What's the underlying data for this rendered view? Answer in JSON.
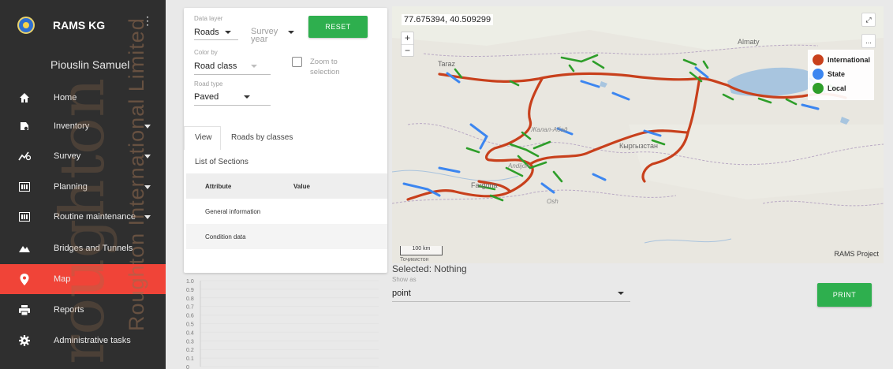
{
  "sidebar": {
    "app_title": "RAMS KG",
    "user_name": "Piouslin Samuel",
    "items": [
      {
        "label": "Home",
        "icon": "home-icon"
      },
      {
        "label": "Inventory",
        "icon": "inventory-icon"
      },
      {
        "label": "Survey",
        "icon": "survey-icon"
      },
      {
        "label": "Planning",
        "icon": "planning-icon"
      },
      {
        "label": "Routine maintenance",
        "icon": "routine-maintenance-icon"
      },
      {
        "label": "Bridges and Tunnels",
        "icon": "bridges-tunnels-icon"
      },
      {
        "label": "Map",
        "icon": "map-pin-icon"
      },
      {
        "label": "Reports",
        "icon": "print-icon"
      },
      {
        "label": "Administrative tasks",
        "icon": "gear-icon"
      }
    ],
    "active_item": "Map",
    "active_color": "#f04438"
  },
  "watermark": {
    "line1": "Roughton International Limited",
    "line2": "roughton"
  },
  "controls": {
    "data_layer_label": "Data layer",
    "data_layer_value": "Roads",
    "survey_year_placeholder": "Survey year",
    "reset_label": "RESET",
    "color_by_label": "Color by",
    "color_by_value": "Road class",
    "zoom_to_selection_label": "Zoom to selection",
    "road_type_label": "Road type",
    "road_type_value": "Paved",
    "tabs": [
      "View",
      "Roads by classes"
    ],
    "list_title": "List of Sections",
    "table_headers": [
      "Attribute",
      "Value"
    ],
    "table_rows": [
      "General information",
      "Condition data"
    ]
  },
  "chart_data": {
    "type": "line",
    "yticks": [
      "1.0",
      "0.9",
      "0.8",
      "0.7",
      "0.6",
      "0.5",
      "0.4",
      "0.3",
      "0.2",
      "0.1",
      "0"
    ],
    "ylim": [
      0,
      1
    ],
    "series": []
  },
  "map": {
    "coords": "77.675394, 40.509299",
    "zoom_in": "+",
    "zoom_out": "−",
    "fullscreen_icon": "expand-icon",
    "more_label": "...",
    "legend": [
      {
        "label": "International",
        "color": "#c8401c"
      },
      {
        "label": "State",
        "color": "#3c86f0"
      },
      {
        "label": "Local",
        "color": "#2e9e2a"
      }
    ],
    "scale_label": "100 km",
    "attribution": "RAMS Project",
    "place_labels": [
      "Almaty",
      "Taraz",
      "Кыргызстан",
      "Жалал-Абад",
      "Andijon",
      "Fargona",
      "Osh",
      "Тоҷикистон"
    ]
  },
  "selection": {
    "selected_text": "Selected: Nothing"
  },
  "show_as": {
    "label": "Show as",
    "value": "point"
  },
  "print_label": "PRINT",
  "colors": {
    "button_green": "#2eaf4e",
    "sidebar_bg": "#2f2f2f"
  }
}
